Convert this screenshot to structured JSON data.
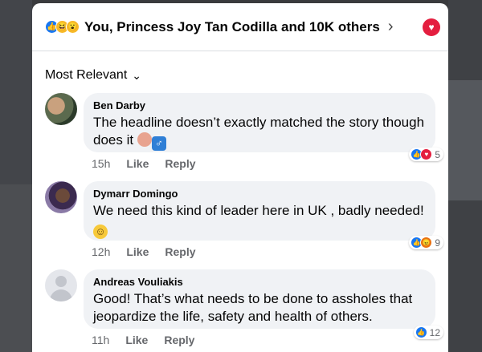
{
  "header": {
    "reactions": [
      "like-icon",
      "haha-icon",
      "wow-icon"
    ],
    "title": "You, Princess Joy Tan Codilla and 10K others",
    "chevron": "›",
    "love_icon": "heart-icon"
  },
  "sort": {
    "label": "Most Relevant",
    "chevron": "⌄"
  },
  "comments": [
    {
      "author": "Ben Darby",
      "text": "The headline doesn’t exactly matched the story though does it",
      "emoji": [
        "person-bald-emoji",
        "male-sign-emoji"
      ],
      "time": "15h",
      "like_label": "Like",
      "reply_label": "Reply",
      "reactions": [
        "like",
        "love"
      ],
      "reaction_count": "5"
    },
    {
      "author": "Dymarr Domingo",
      "text": "We need this kind of leader here in UK , badly needed!",
      "emoji": [
        "smile-emoji"
      ],
      "time": "12h",
      "like_label": "Like",
      "reply_label": "Reply",
      "reactions": [
        "like",
        "angry"
      ],
      "reaction_count": "9"
    },
    {
      "author": "Andreas Vouliakis",
      "text": "Good! That’s what needs to be done to assholes that jeopardize the life, safety and health of others.",
      "emoji": [],
      "time": "11h",
      "like_label": "Like",
      "reply_label": "Reply",
      "reactions": [
        "like"
      ],
      "reaction_count": "12"
    }
  ],
  "colors": {
    "like": "#1877f2",
    "love": "#e41e3f",
    "angry": "#e9710f",
    "bubble": "#f0f2f5",
    "meta_text": "#65676b"
  }
}
